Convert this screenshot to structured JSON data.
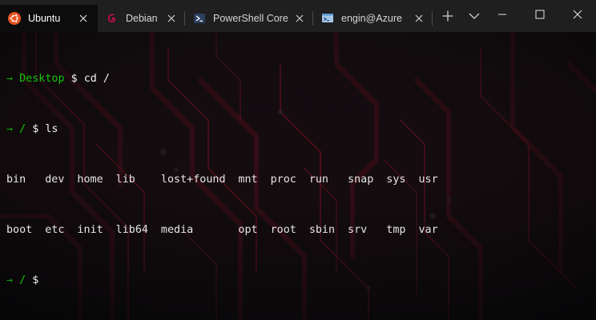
{
  "tabs": [
    {
      "label": "Ubuntu",
      "icon": "ubuntu-icon",
      "active": true
    },
    {
      "label": "Debian",
      "icon": "debian-icon",
      "active": false
    },
    {
      "label": "PowerShell Core",
      "icon": "powershell-icon",
      "active": false
    },
    {
      "label": "engin@Azure",
      "icon": "azure-cloud-shell-icon",
      "active": false
    }
  ],
  "terminal": {
    "prompt_arrow": "→",
    "dollar": "$",
    "lines": [
      {
        "cwd": "Desktop",
        "command": "cd /"
      },
      {
        "cwd": "/",
        "command": "ls"
      }
    ],
    "ls_output": [
      [
        "bin",
        "dev",
        "home",
        "lib",
        "lost+found",
        "mnt",
        "proc",
        "run",
        "snap",
        "sys",
        "usr"
      ],
      [
        "boot",
        "etc",
        "init",
        "lib64",
        "media",
        "opt",
        "root",
        "sbin",
        "srv",
        "tmp",
        "var"
      ]
    ],
    "current_cwd": "/"
  },
  "colors": {
    "prompt_green": "#16c60c",
    "arrow_green": "#13a10e",
    "titlebar_bg": "#1f1f1f",
    "terminal_bg": "#0c0c0c",
    "ubuntu_orange": "#e95420",
    "debian_red": "#d70a53"
  }
}
